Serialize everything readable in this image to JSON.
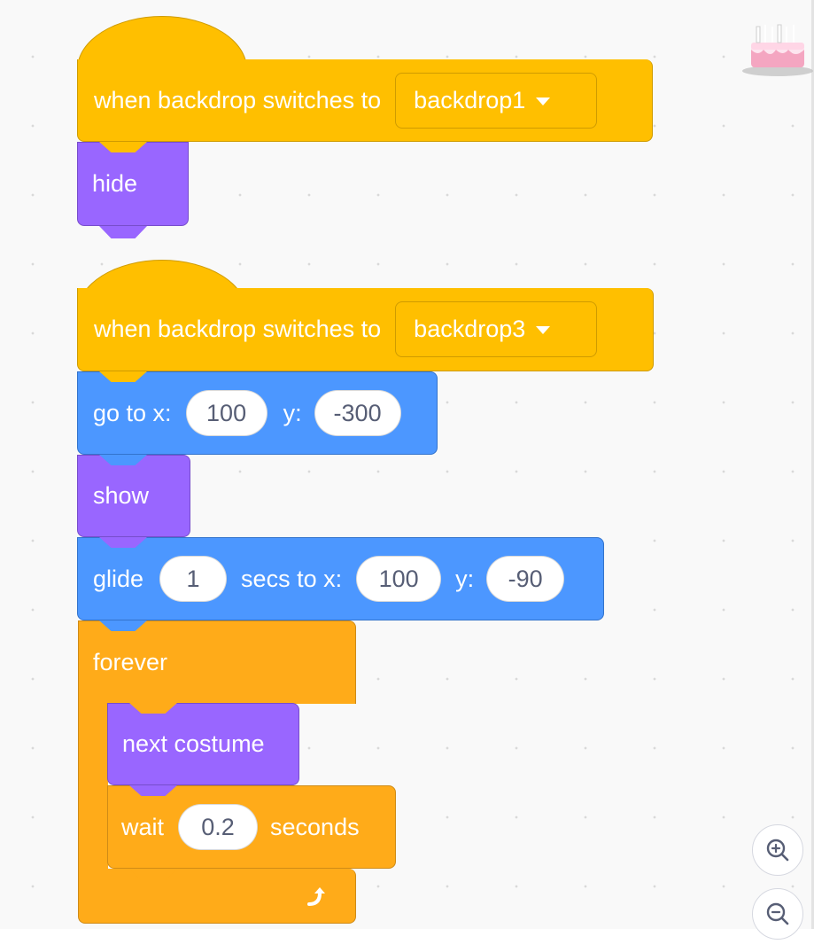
{
  "script1": {
    "hat_label": "when backdrop switches to",
    "hat_value": "backdrop1",
    "hide_label": "hide"
  },
  "script2": {
    "hat_label": "when backdrop switches to",
    "hat_value": "backdrop3",
    "goto": {
      "label_x": "go to x:",
      "x": "100",
      "label_y": "y:",
      "y": "-300"
    },
    "show_label": "show",
    "glide": {
      "label": "glide",
      "secs": "1",
      "label_secs": "secs to x:",
      "x": "100",
      "label_y": "y:",
      "y": "-90"
    },
    "forever_label": "forever",
    "next_costume_label": "next costume",
    "wait": {
      "label": "wait",
      "value": "0.2",
      "label_after": "seconds"
    }
  },
  "icons": {
    "sprite": "birthday-cake-icon",
    "zoom_in": "zoom-in-icon",
    "zoom_out": "zoom-out-icon",
    "loop_arrow": "loop-arrow-icon"
  },
  "colors": {
    "events": "#ffbf00",
    "looks": "#9966ff",
    "motion": "#4c97ff",
    "control": "#ffab19"
  }
}
